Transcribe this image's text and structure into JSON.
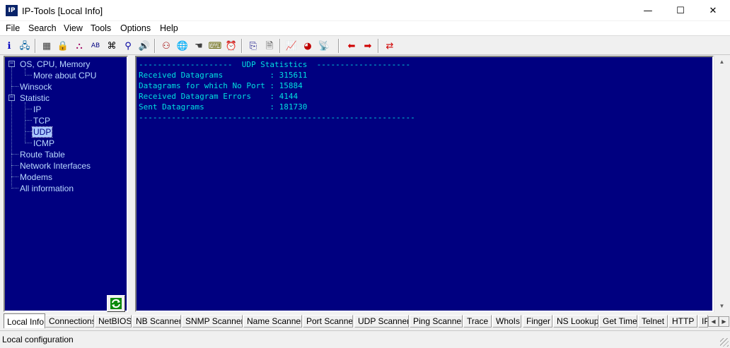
{
  "window": {
    "title": "IP-Tools [Local Info]",
    "app_icon_label": "IP",
    "minimize_glyph": "—",
    "maximize_glyph": "☐",
    "close_glyph": "✕"
  },
  "menu": {
    "items": [
      "File",
      "Search",
      "View",
      "Tools",
      "Options",
      "Help"
    ]
  },
  "toolbar": {
    "icons": [
      {
        "name": "about-icon",
        "glyph": "ℹ",
        "color": "#0000c0"
      },
      {
        "name": "computers-icon",
        "glyph": "🖧",
        "color": "#0060a0"
      },
      {
        "name": "calculator-icon",
        "glyph": "▦",
        "color": "#404040"
      },
      {
        "name": "lock-icon",
        "glyph": "🔒",
        "color": "#806000"
      },
      {
        "name": "network-tree-icon",
        "glyph": "⛬",
        "color": "#a00060"
      },
      {
        "name": "name-lookup-icon",
        "glyph": "AB",
        "color": "#000080"
      },
      {
        "name": "binoculars-icon",
        "glyph": "⌘",
        "color": "#000000"
      },
      {
        "name": "scanner-icon",
        "glyph": "⚲",
        "color": "#0000a0"
      },
      {
        "name": "speaker-icon",
        "glyph": "🔊",
        "color": "#404040"
      },
      {
        "name": "users-icon",
        "glyph": "⚇",
        "color": "#a00000"
      },
      {
        "name": "globe-icon",
        "glyph": "🌐",
        "color": "#006000"
      },
      {
        "name": "finger-icon",
        "glyph": "☚",
        "color": "#404040"
      },
      {
        "name": "telnet-icon",
        "glyph": "⌨",
        "color": "#606000"
      },
      {
        "name": "alarm-clock-icon",
        "glyph": "⏰",
        "color": "#c00000"
      },
      {
        "name": "trace-icon",
        "glyph": "⎘",
        "color": "#000080"
      },
      {
        "name": "document-icon",
        "glyph": "🗎",
        "color": "#404040"
      },
      {
        "name": "graph-icon",
        "glyph": "📈",
        "color": "#0000a0"
      },
      {
        "name": "pie-chart-icon",
        "glyph": "◕",
        "color": "#c00000"
      },
      {
        "name": "satellite-dish-icon",
        "glyph": "📡",
        "color": "#606060"
      },
      {
        "name": "arrow-left-icon",
        "glyph": "⬅",
        "color": "#d00000"
      },
      {
        "name": "arrow-right-icon",
        "glyph": "➡",
        "color": "#d00000"
      },
      {
        "name": "swap-arrows-icon",
        "glyph": "⇄",
        "color": "#d00000"
      }
    ]
  },
  "tree": {
    "nodes": [
      {
        "label": "OS, CPU, Memory",
        "toggle": "−"
      },
      {
        "label": "More about CPU"
      },
      {
        "label": "Winsock"
      },
      {
        "label": "Statistic",
        "toggle": "−"
      },
      {
        "label": "IP"
      },
      {
        "label": "TCP"
      },
      {
        "label": "UDP",
        "selected": true
      },
      {
        "label": "ICMP"
      },
      {
        "label": "Route Table"
      },
      {
        "label": "Network Interfaces"
      },
      {
        "label": "Modems"
      },
      {
        "label": "All information"
      }
    ]
  },
  "output": {
    "lines": [
      "--------------------  UDP Statistics  --------------------",
      "Received Datagrams          : 315611",
      "Datagrams for which No Port : 15884",
      "Received Datagram Errors    : 4144",
      "Sent Datagrams              : 181730",
      "-----------------------------------------------------------"
    ]
  },
  "tabs": {
    "items": [
      "Local Info",
      "Connections",
      "NetBIOS",
      "NB Scanner",
      "SNMP Scanner",
      "Name Scanner",
      "Port Scanner",
      "UDP Scanner",
      "Ping Scanner",
      "Trace",
      "WhoIs",
      "Finger",
      "NS Lookup",
      "Get Time",
      "Telnet",
      "HTTP",
      "IP-Monitor"
    ],
    "active": "Local Info"
  },
  "status": {
    "text": "Local configuration"
  },
  "colors": {
    "panel_bg": "#000080",
    "output_text": "#00e0e0",
    "tree_text": "#b9d9ff"
  }
}
